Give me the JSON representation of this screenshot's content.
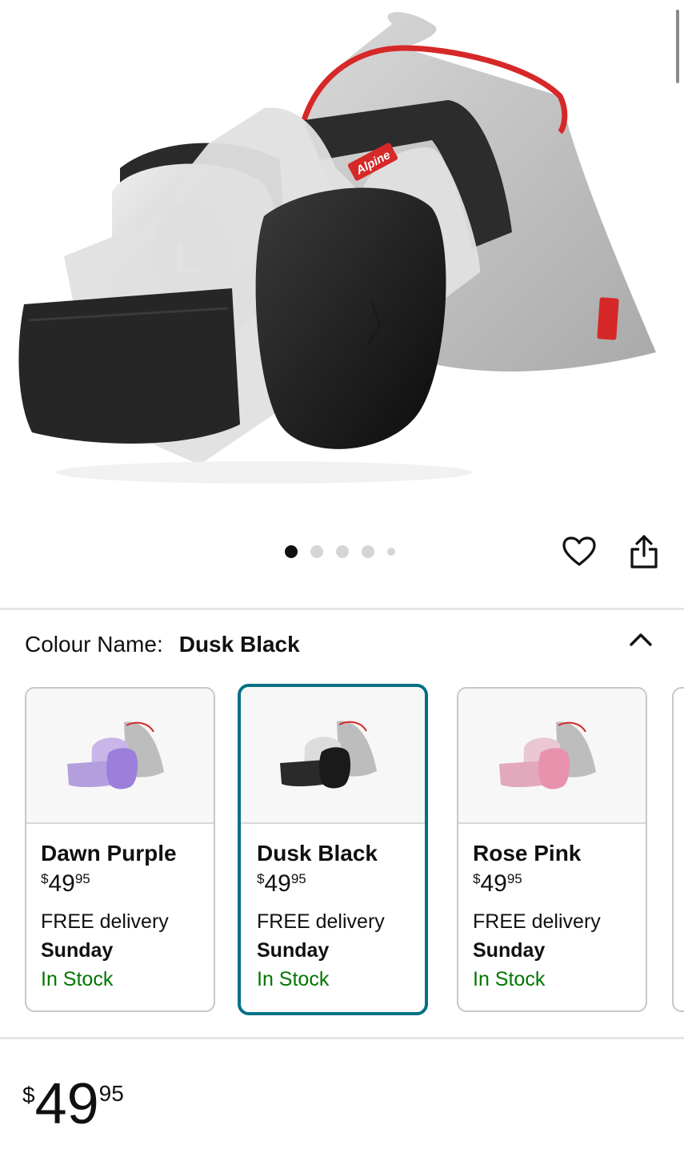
{
  "carousel": {
    "total": 5,
    "active_index": 0
  },
  "hero": {
    "brand_label": "Alpine",
    "cup_letter": "L"
  },
  "colour": {
    "label": "Colour Name:",
    "selected": "Dusk Black"
  },
  "variants": [
    {
      "name": "Dawn Purple",
      "currency": "$",
      "whole": "49",
      "fraction": "95",
      "delivery": "FREE delivery",
      "day": "Sunday",
      "stock": "In Stock",
      "selected": false
    },
    {
      "name": "Dusk Black",
      "currency": "$",
      "whole": "49",
      "fraction": "95",
      "delivery": "FREE delivery",
      "day": "Sunday",
      "stock": "In Stock",
      "selected": true
    },
    {
      "name": "Rose Pink",
      "currency": "$",
      "whole": "49",
      "fraction": "95",
      "delivery": "FREE delivery",
      "day": "Sunday",
      "stock": "In Stock",
      "selected": false
    }
  ],
  "price": {
    "currency": "$",
    "whole": "49",
    "fraction": "95"
  },
  "colors": {
    "accent": "#007185",
    "in_stock": "#007600",
    "brand_red": "#d62828"
  },
  "icons": {
    "wishlist": "heart-icon",
    "share": "share-icon",
    "collapse": "chevron-up-icon"
  }
}
